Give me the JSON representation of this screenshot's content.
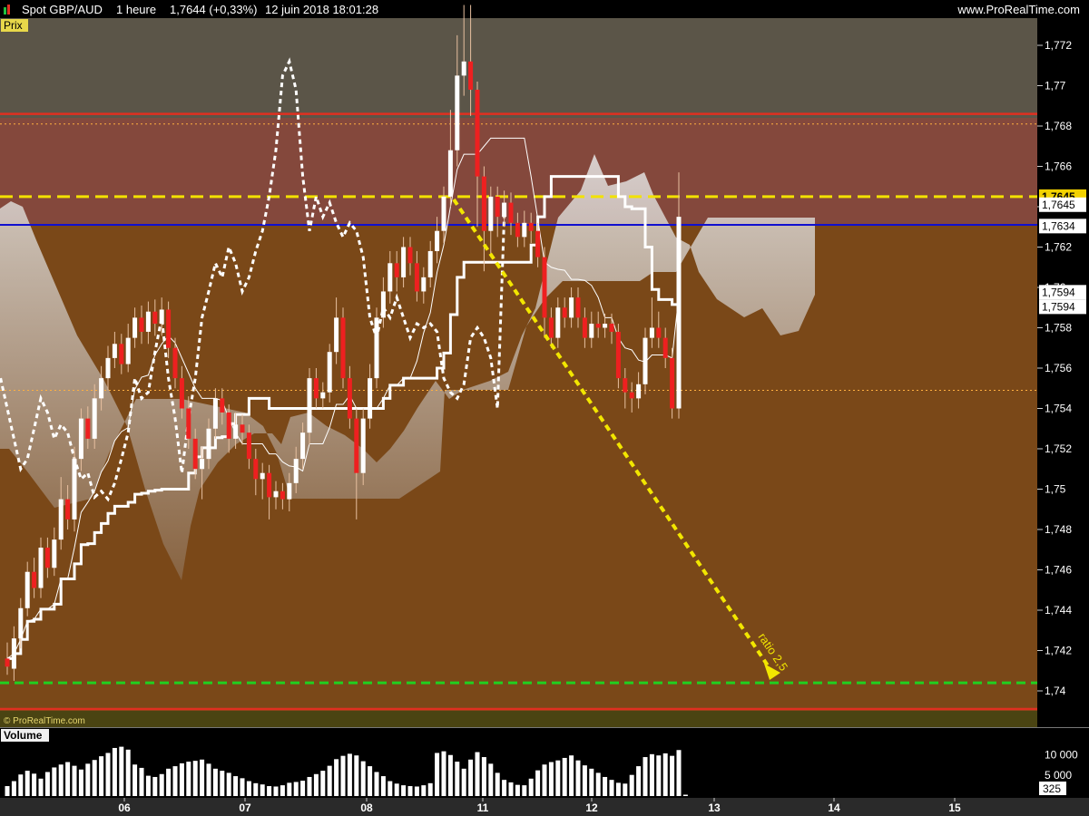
{
  "header": {
    "instrument": "Spot GBP/AUD",
    "interval": "1 heure",
    "last": "1,7644 (+0,33%)",
    "datetime": "12 juin 2018 18:01:28",
    "site": "www.ProRealTime.com"
  },
  "panels": {
    "price_label": "Prix",
    "volume_label": "Volume",
    "watermark": "© ProRealTime.com"
  },
  "chart_data": {
    "type": "candlestick",
    "y_ticks": [
      "1,772",
      "1,77",
      "1,768",
      "1,766",
      "1,764",
      "1,762",
      "1,76",
      "1,758",
      "1,756",
      "1,754",
      "1,752",
      "1,75",
      "1,748",
      "1,746",
      "1,744",
      "1,742",
      "1,74"
    ],
    "ylim": [
      1.7388,
      1.7735
    ],
    "x_ticks": [
      "06",
      "07",
      "08",
      "11",
      "12",
      "13",
      "14",
      "15"
    ],
    "price_tags": [
      "1,7645",
      "1,7645",
      "1,7634",
      "1,7594",
      "1,7594"
    ],
    "volume_ticks": [
      "10 000",
      "5 000"
    ],
    "volume_last": "325",
    "annotation": "ratio 2,5",
    "levels": [
      {
        "name": "red-upper",
        "value": 1.7686,
        "color": "#e03020"
      },
      {
        "name": "orange-dotted-top",
        "value": 1.7681,
        "color": "#ffb040"
      },
      {
        "name": "yellow-dashed",
        "value": 1.7645,
        "color": "#f2e200"
      },
      {
        "name": "blue",
        "value": 1.7631,
        "color": "#1010d0"
      },
      {
        "name": "orange-dotted-low",
        "value": 1.7549,
        "color": "#ffb040"
      },
      {
        "name": "green-dashed",
        "value": 1.7404,
        "color": "#20d020"
      },
      {
        "name": "red-lower",
        "value": 1.7391,
        "color": "#e03020"
      }
    ],
    "candles": [
      [
        1.7416,
        1.7412,
        1.7424,
        1.7408
      ],
      [
        1.7411,
        1.7426,
        1.7432,
        1.7405
      ],
      [
        1.7426,
        1.7441,
        1.7446,
        1.7421
      ],
      [
        1.7441,
        1.7459,
        1.7464,
        1.7437
      ],
      [
        1.7459,
        1.7451,
        1.7466,
        1.7446
      ],
      [
        1.7451,
        1.7471,
        1.7476,
        1.7446
      ],
      [
        1.7471,
        1.7461,
        1.7476,
        1.7456
      ],
      [
        1.7461,
        1.7475,
        1.7481,
        1.7457
      ],
      [
        1.7475,
        1.7495,
        1.7506,
        1.747
      ],
      [
        1.7495,
        1.7485,
        1.7502,
        1.748
      ],
      [
        1.7485,
        1.7515,
        1.7521,
        1.7479
      ],
      [
        1.7515,
        1.7535,
        1.754,
        1.7509
      ],
      [
        1.7535,
        1.7525,
        1.7541,
        1.752
      ],
      [
        1.7525,
        1.7545,
        1.7552,
        1.752
      ],
      [
        1.7545,
        1.7555,
        1.7561,
        1.7539
      ],
      [
        1.7555,
        1.7565,
        1.7571,
        1.7549
      ],
      [
        1.7565,
        1.7572,
        1.7578,
        1.756
      ],
      [
        1.7572,
        1.7562,
        1.7577,
        1.7557
      ],
      [
        1.7562,
        1.7575,
        1.7582,
        1.7558
      ],
      [
        1.7575,
        1.7585,
        1.759,
        1.757
      ],
      [
        1.7585,
        1.7578,
        1.7591,
        1.7572
      ],
      [
        1.7578,
        1.7588,
        1.7593,
        1.7572
      ],
      [
        1.7588,
        1.7582,
        1.7594,
        1.7576
      ],
      [
        1.7582,
        1.7589,
        1.7595,
        1.7576
      ],
      [
        1.7589,
        1.757,
        1.7593,
        1.7565
      ],
      [
        1.757,
        1.7555,
        1.7575,
        1.755
      ],
      [
        1.7555,
        1.754,
        1.7561,
        1.7535
      ],
      [
        1.754,
        1.7525,
        1.7546,
        1.752
      ],
      [
        1.7525,
        1.751,
        1.753,
        1.7505
      ],
      [
        1.751,
        1.7515,
        1.7521,
        1.7495
      ],
      [
        1.7515,
        1.753,
        1.7535,
        1.751
      ],
      [
        1.753,
        1.7545,
        1.755,
        1.7525
      ],
      [
        1.7545,
        1.7538,
        1.755,
        1.7532
      ],
      [
        1.7538,
        1.7525,
        1.7542,
        1.7518
      ],
      [
        1.7525,
        1.7532,
        1.7538,
        1.752
      ],
      [
        1.7532,
        1.7528,
        1.7537,
        1.7522
      ],
      [
        1.7528,
        1.7515,
        1.7532,
        1.751
      ],
      [
        1.7515,
        1.7505,
        1.752,
        1.7497
      ],
      [
        1.7505,
        1.7508,
        1.7513,
        1.7495
      ],
      [
        1.7508,
        1.7496,
        1.7512,
        1.7485
      ],
      [
        1.7496,
        1.7499,
        1.7504,
        1.749
      ],
      [
        1.7499,
        1.7495,
        1.7503,
        1.749
      ],
      [
        1.7495,
        1.7503,
        1.7508,
        1.7489
      ],
      [
        1.7503,
        1.7515,
        1.7521,
        1.7498
      ],
      [
        1.7515,
        1.7528,
        1.7533,
        1.751
      ],
      [
        1.7528,
        1.7555,
        1.756,
        1.7522
      ],
      [
        1.7555,
        1.7545,
        1.756,
        1.754
      ],
      [
        1.7545,
        1.7548,
        1.7553,
        1.754
      ],
      [
        1.7548,
        1.7568,
        1.7572,
        1.7543
      ],
      [
        1.7568,
        1.7585,
        1.7595,
        1.7562
      ],
      [
        1.7585,
        1.7555,
        1.759,
        1.755
      ],
      [
        1.7555,
        1.7535,
        1.7561,
        1.753
      ],
      [
        1.7535,
        1.7508,
        1.754,
        1.7485
      ],
      [
        1.7508,
        1.7535,
        1.754,
        1.7502
      ],
      [
        1.7535,
        1.7555,
        1.7562,
        1.753
      ],
      [
        1.7555,
        1.7585,
        1.759,
        1.755
      ],
      [
        1.7585,
        1.7598,
        1.7605,
        1.758
      ],
      [
        1.7598,
        1.7612,
        1.7618,
        1.7592
      ],
      [
        1.7612,
        1.7605,
        1.7618,
        1.7598
      ],
      [
        1.7605,
        1.762,
        1.7625,
        1.76
      ],
      [
        1.762,
        1.7612,
        1.7625,
        1.7606
      ],
      [
        1.7612,
        1.7598,
        1.7618,
        1.7593
      ],
      [
        1.7598,
        1.7605,
        1.761,
        1.7592
      ],
      [
        1.7605,
        1.7618,
        1.7623,
        1.76
      ],
      [
        1.7618,
        1.7628,
        1.7635,
        1.7612
      ],
      [
        1.7628,
        1.7645,
        1.765,
        1.7622
      ],
      [
        1.7645,
        1.7668,
        1.7688,
        1.764
      ],
      [
        1.7668,
        1.7705,
        1.7725,
        1.766
      ],
      [
        1.7705,
        1.7712,
        1.774,
        1.7695
      ],
      [
        1.7712,
        1.7698,
        1.774,
        1.7685
      ],
      [
        1.7698,
        1.7655,
        1.7702,
        1.763
      ],
      [
        1.7655,
        1.7628,
        1.766,
        1.7608
      ],
      [
        1.7628,
        1.7645,
        1.765,
        1.7615
      ],
      [
        1.7645,
        1.7635,
        1.765,
        1.7625
      ],
      [
        1.7635,
        1.7642,
        1.7648,
        1.763
      ],
      [
        1.7642,
        1.7632,
        1.7647,
        1.7626
      ],
      [
        1.7632,
        1.7625,
        1.7637,
        1.762
      ],
      [
        1.7625,
        1.7632,
        1.7638,
        1.762
      ],
      [
        1.7632,
        1.7628,
        1.7637,
        1.7622
      ],
      [
        1.7628,
        1.7615,
        1.7632,
        1.761
      ],
      [
        1.7615,
        1.7585,
        1.762,
        1.7575
      ],
      [
        1.7585,
        1.7575,
        1.759,
        1.757
      ],
      [
        1.7575,
        1.759,
        1.7595,
        1.757
      ],
      [
        1.759,
        1.7585,
        1.7595,
        1.758
      ],
      [
        1.7585,
        1.7595,
        1.76,
        1.758
      ],
      [
        1.7595,
        1.7585,
        1.76,
        1.758
      ],
      [
        1.7585,
        1.7575,
        1.759,
        1.757
      ],
      [
        1.7575,
        1.7582,
        1.7588,
        1.757
      ],
      [
        1.7582,
        1.758,
        1.7588,
        1.7575
      ],
      [
        1.758,
        1.7582,
        1.7587,
        1.7575
      ],
      [
        1.7582,
        1.7578,
        1.7587,
        1.7572
      ],
      [
        1.7578,
        1.7555,
        1.7582,
        1.755
      ],
      [
        1.7555,
        1.7548,
        1.756,
        1.754
      ],
      [
        1.7548,
        1.7545,
        1.7553,
        1.7538
      ],
      [
        1.7545,
        1.7552,
        1.7558,
        1.754
      ],
      [
        1.7552,
        1.7575,
        1.758,
        1.7547
      ],
      [
        1.7575,
        1.758,
        1.7595,
        1.757
      ],
      [
        1.758,
        1.7575,
        1.7588,
        1.757
      ],
      [
        1.7575,
        1.7565,
        1.758,
        1.756
      ],
      [
        1.7565,
        1.754,
        1.757,
        1.7535
      ],
      [
        1.754,
        1.7635,
        1.7657,
        1.7535
      ]
    ],
    "volumes": [
      2400,
      3600,
      5200,
      6100,
      5400,
      4200,
      5800,
      6900,
      7600,
      8200,
      7300,
      6400,
      7800,
      8700,
      9600,
      10400,
      11600,
      11900,
      11200,
      7600,
      6800,
      4900,
      4600,
      5300,
      6600,
      7200,
      7900,
      8300,
      8500,
      8800,
      7800,
      6600,
      6100,
      5600,
      4800,
      4300,
      3600,
      3100,
      2800,
      2400,
      2300,
      2600,
      3200,
      3400,
      3700,
      4600,
      5300,
      6100,
      7300,
      8900,
      9700,
      10200,
      9800,
      8400,
      7200,
      5800,
      4800,
      3600,
      3000,
      2600,
      2400,
      2300,
      2600,
      3100,
      10400,
      10800,
      9900,
      8300,
      6600,
      8800,
      10600,
      9400,
      7800,
      5600,
      3900,
      3300,
      2700,
      2600,
      4200,
      6200,
      7600,
      8200,
      8600,
      9200,
      9800,
      8600,
      7400,
      6600,
      5600,
      4600,
      3900,
      3200,
      3000,
      5100,
      7200,
      9400,
      10100,
      9800,
      10300,
      9700,
      11100,
      325
    ]
  }
}
